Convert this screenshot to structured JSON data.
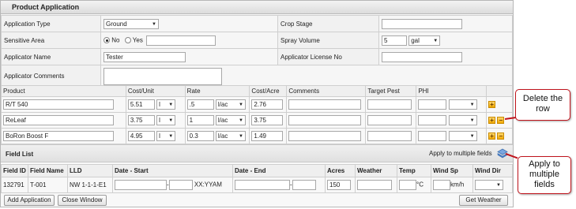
{
  "title": "Product Application",
  "form": {
    "application_type_label": "Application Type",
    "application_type_value": "Ground",
    "crop_stage_label": "Crop Stage",
    "crop_stage_value": "",
    "sensitive_area_label": "Sensitive Area",
    "no_label": "No",
    "yes_label": "Yes",
    "spray_volume_label": "Spray Volume",
    "spray_volume_value": "5",
    "spray_volume_unit": "gal",
    "applicator_name_label": "Applicator Name",
    "applicator_name_value": "Tester",
    "applicator_license_label": "Applicator License No",
    "applicator_comments_label": "Applicator Comments"
  },
  "products": {
    "headers": [
      "Product",
      "Cost/Unit",
      "Rate",
      "Cost/Acre",
      "Comments",
      "Target Pest",
      "PHI"
    ],
    "rows": [
      {
        "product": "R/T 540",
        "cost_unit": "5.51",
        "unit": "l",
        "rate": ".5",
        "rate_unit": "l/ac",
        "cost_acre": "2.76"
      },
      {
        "product": "ReLeaf",
        "cost_unit": "3.75",
        "unit": "l",
        "rate": "1",
        "rate_unit": "l/ac",
        "cost_acre": "3.75"
      },
      {
        "product": "BoRon Boost F",
        "cost_unit": "4.95",
        "unit": "l",
        "rate": "0.3",
        "rate_unit": "l/ac",
        "cost_acre": "1.49"
      }
    ]
  },
  "field_list": {
    "title": "Field List",
    "apply_label": "Apply to multiple fields",
    "headers": [
      "Field ID",
      "Field Name",
      "LLD",
      "Date - Start",
      "Date - End",
      "Acres",
      "Weather",
      "Temp",
      "Wind Sp",
      "Wind Dir"
    ],
    "row": {
      "field_id": "132791",
      "field_name": "T-001",
      "lld": "NW 1-1-1-E1",
      "date_sep": "-",
      "date_format": "XX:YYAM",
      "date_end_sep": "-",
      "acres": "150",
      "temp_unit": "°C",
      "wind_unit": "km/h"
    }
  },
  "buttons": {
    "add_application": "Add Application",
    "close_window": "Close Window",
    "get_weather": "Get Weather"
  },
  "callouts": {
    "delete_row": "Delete the row",
    "apply_multiple": "Apply to multiple fields"
  },
  "colors": {
    "callout_border": "#c0141c",
    "icon_orange": "#f0a800"
  }
}
